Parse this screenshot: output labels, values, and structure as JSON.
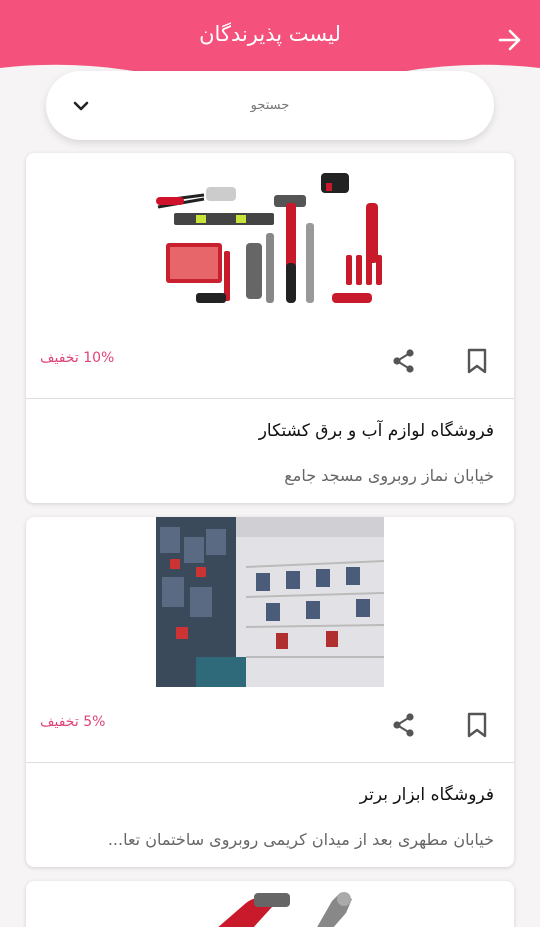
{
  "header": {
    "title": "لیست پذیرندگان",
    "color": "#f0507a"
  },
  "search": {
    "placeholder": "جستجو"
  },
  "cards": [
    {
      "image_icon": "tools-set-image",
      "discount": "10% تخفیف",
      "title": "فروشگاه لوازم آب و برق کشتکار",
      "address": "خیابان نماز روبروی مسجد جامع"
    },
    {
      "image_icon": "tool-shop-shelves-image",
      "discount": "5% تخفیف",
      "title": "فروشگاه ابزار برتر",
      "address": "خیابان مطهری بعد از میدان کریمی روبروی ساختمان تعا..."
    },
    {
      "image_icon": "hammer-wrench-image"
    }
  ],
  "colors": {
    "accent": "#e0427a",
    "background": "#f6f4f4"
  }
}
